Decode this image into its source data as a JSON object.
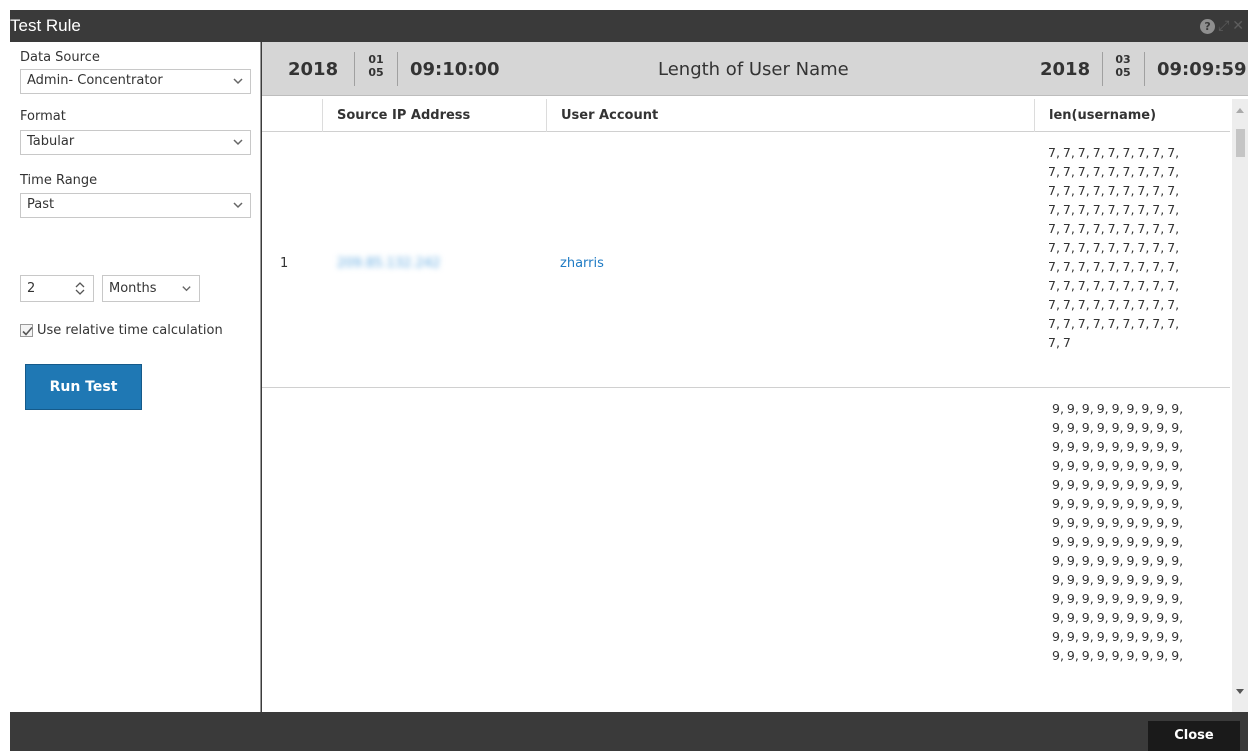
{
  "window": {
    "title": "Test Rule"
  },
  "form": {
    "data_source_label": "Data Source",
    "data_source_value": "Admin- Concentrator",
    "format_label": "Format",
    "format_value": "Tabular",
    "time_range_label": "Time Range",
    "time_range_value": "Past",
    "amount_value": "2",
    "unit_value": "Months",
    "relative_label": "Use relative time calculation",
    "relative_checked": true,
    "run_label": "Run Test"
  },
  "timebar": {
    "start_year": "2018",
    "start_month": "01",
    "start_day": "05",
    "start_time": "09:10:00",
    "rule_name": "Length of User Name",
    "end_year": "2018",
    "end_month": "03",
    "end_day": "05",
    "end_time": "09:09:59"
  },
  "table": {
    "columns": [
      "Source IP Address",
      "User Account",
      "len(username)"
    ],
    "rows": [
      {
        "index": "1",
        "source_ip": "209.85.132.242",
        "user_account": "zharris",
        "len_username": "7, 7, 7, 7, 7, 7, 7, 7, 7,\n7, 7, 7, 7, 7, 7, 7, 7, 7,\n7, 7, 7, 7, 7, 7, 7, 7, 7,\n7, 7, 7, 7, 7, 7, 7, 7, 7,\n7, 7, 7, 7, 7, 7, 7, 7, 7,\n7, 7, 7, 7, 7, 7, 7, 7, 7,\n7, 7, 7, 7, 7, 7, 7, 7, 7,\n7, 7, 7, 7, 7, 7, 7, 7, 7,\n7, 7, 7, 7, 7, 7, 7, 7, 7,\n7, 7, 7, 7, 7, 7, 7, 7, 7,\n7, 7"
      },
      {
        "index": "",
        "source_ip": "",
        "user_account": "",
        "len_username": "9, 9, 9, 9, 9, 9, 9, 9, 9,\n9, 9, 9, 9, 9, 9, 9, 9, 9,\n9, 9, 9, 9, 9, 9, 9, 9, 9,\n9, 9, 9, 9, 9, 9, 9, 9, 9,\n9, 9, 9, 9, 9, 9, 9, 9, 9,\n9, 9, 9, 9, 9, 9, 9, 9, 9,\n9, 9, 9, 9, 9, 9, 9, 9, 9,\n9, 9, 9, 9, 9, 9, 9, 9, 9,\n9, 9, 9, 9, 9, 9, 9, 9, 9,\n9, 9, 9, 9, 9, 9, 9, 9, 9,\n9, 9, 9, 9, 9, 9, 9, 9, 9,\n9, 9, 9, 9, 9, 9, 9, 9, 9,\n9, 9, 9, 9, 9, 9, 9, 9, 9,\n9, 9, 9, 9, 9, 9, 9, 9, 9,"
      }
    ]
  },
  "footer": {
    "close_label": "Close"
  },
  "colors": {
    "accent": "#1f78b4",
    "link": "#1f7bc4",
    "chrome": "#3a3a3a"
  },
  "icons": [
    "help-icon",
    "expand-icon",
    "close-x-icon",
    "chevron-down-icon",
    "spinner-icon",
    "check-icon"
  ]
}
